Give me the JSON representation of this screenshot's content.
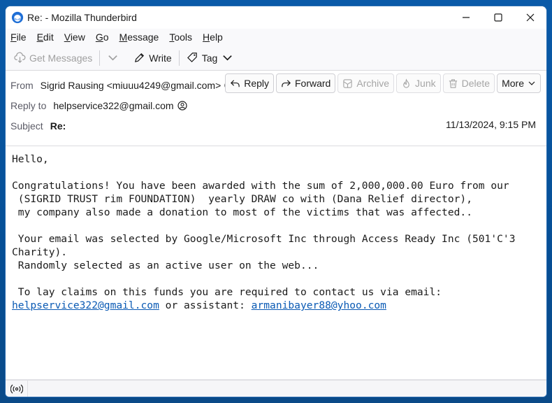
{
  "window": {
    "title": "Re: - Mozilla Thunderbird"
  },
  "menubar": {
    "items": [
      {
        "label": "File",
        "accel": "F",
        "rest": "ile"
      },
      {
        "label": "Edit",
        "accel": "E",
        "rest": "dit"
      },
      {
        "label": "View",
        "accel": "V",
        "rest": "iew"
      },
      {
        "label": "Go",
        "accel": "G",
        "rest": "o"
      },
      {
        "label": "Message",
        "accel": "M",
        "rest": "essage"
      },
      {
        "label": "Tools",
        "accel": "T",
        "rest": "ools"
      },
      {
        "label": "Help",
        "accel": "H",
        "rest": "elp"
      }
    ]
  },
  "toolbar": {
    "get_messages_label": "Get Messages",
    "write_label": "Write",
    "tag_label": "Tag"
  },
  "header": {
    "from_label": "From",
    "from_value": "Sigrid Rausing <miuuu4249@gmail.com>",
    "reply_to_label": "Reply to",
    "reply_to_value": "helpservice322@gmail.com",
    "subject_label": "Subject",
    "subject_value": "Re:",
    "date": "11/13/2024, 9:15 PM",
    "actions": {
      "reply": "Reply",
      "forward": "Forward",
      "archive": "Archive",
      "junk": "Junk",
      "delete": "Delete",
      "more": "More"
    }
  },
  "message": {
    "greeting": "Hello,",
    "para1": "Congratulations! You have been awarded with the sum of 2,000,000.00 Euro from our\n (SIGRID TRUST rim FOUNDATION)  yearly DRAW co with (Dana Relief director),\n my company also made a donation to most of the victims that was affected..",
    "para2": " Your email was selected by Google/Microsoft Inc through Access Ready Inc (501'C'3\nCharity).\n Randomly selected as an active user on the web...",
    "para3": " To lay claims on this funds you are required to contact us via email:",
    "link1": "helpservice322@gmail.com",
    "connector": " or assistant: ",
    "link2": "armanibayer88@yhoo.com"
  },
  "colors": {
    "accent": "#0a5aa8",
    "link": "#0a5ab4"
  }
}
